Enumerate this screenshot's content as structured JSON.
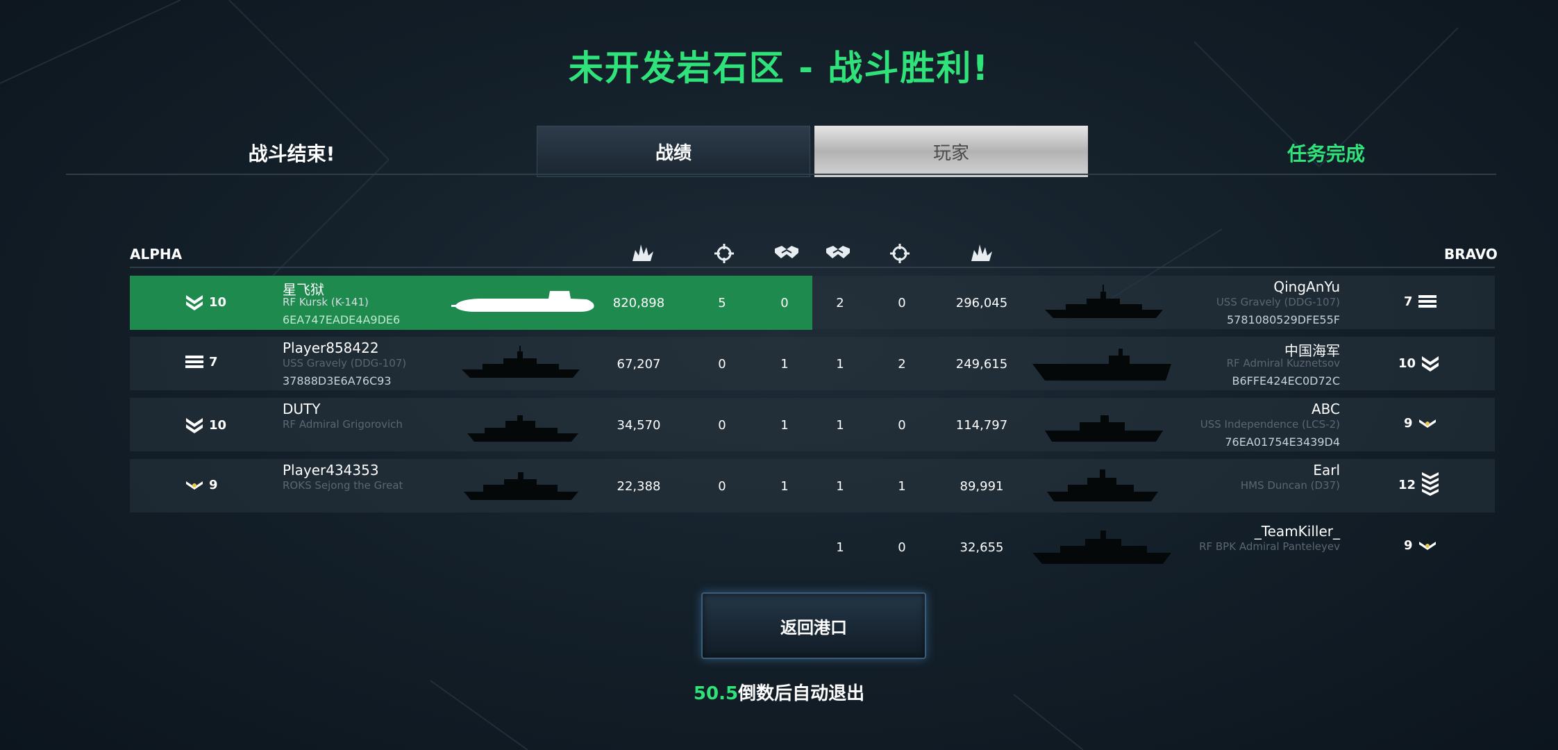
{
  "title": "未开发岩石区 - 战斗胜利!",
  "battle_over": "战斗结束!",
  "mission_complete": "任务完成",
  "tabs": {
    "stats": "战绩",
    "players": "玩家"
  },
  "teams": {
    "alpha": "ALPHA",
    "bravo": "BRAVO"
  },
  "columns": [
    "damage-icon",
    "target-icon",
    "handshake-icon"
  ],
  "alpha": [
    {
      "rank": "10",
      "rank_icon": "chevrons-icon",
      "name": "星飞狱",
      "ship": "RF Kursk (K-141)",
      "id": "6EA747EADE4A9DE6",
      "damage": "820,898",
      "kills": "5",
      "assists": "0"
    },
    {
      "rank": "7",
      "rank_icon": "bars-icon",
      "name": "Player858422",
      "ship": "USS Gravely (DDG-107)",
      "id": "37888D3E6A76C93",
      "damage": "67,207",
      "kills": "0",
      "assists": "1"
    },
    {
      "rank": "10",
      "rank_icon": "chevrons-icon",
      "name": "DUTY",
      "ship": "RF Admiral Grigorovich",
      "id": "",
      "damage": "34,570",
      "kills": "0",
      "assists": "1"
    },
    {
      "rank": "9",
      "rank_icon": "chevron-icon",
      "name": "Player434353",
      "ship": "ROKS Sejong the Great",
      "id": "",
      "damage": "22,388",
      "kills": "0",
      "assists": "1"
    }
  ],
  "bravo": [
    {
      "rank": "7",
      "rank_icon": "bars-icon",
      "name": "QingAnYu",
      "ship": "USS Gravely (DDG-107)",
      "id": "5781080529DFE55F",
      "damage": "296,045",
      "kills": "0",
      "assists": "2"
    },
    {
      "rank": "10",
      "rank_icon": "chevrons-icon",
      "name": "中国海军",
      "ship": "RF Admiral Kuznetsov",
      "id": "B6FFE424EC0D72C",
      "damage": "249,615",
      "kills": "2",
      "assists": "1"
    },
    {
      "rank": "9",
      "rank_icon": "chevron-icon",
      "name": "ABC",
      "ship": "USS Independence (LCS-2)",
      "id": "76EA01754E3439D4",
      "damage": "114,797",
      "kills": "0",
      "assists": "1"
    },
    {
      "rank": "12",
      "rank_icon": "stripes-icon",
      "name": "Earl",
      "ship": "HMS Duncan (D37)",
      "id": "",
      "damage": "89,991",
      "kills": "1",
      "assists": "1"
    },
    {
      "rank": "9",
      "rank_icon": "chevron-icon",
      "name": "_TeamKiller_",
      "ship": "RF BPK Admiral Panteleyev",
      "id": "",
      "damage": "32,655",
      "kills": "0",
      "assists": "1"
    }
  ],
  "return_button": "返回港口",
  "countdown": {
    "seconds": "50.5",
    "text": "倒数后自动退出"
  },
  "colors": {
    "accent": "#2fe37a",
    "highlight_row": "#1e8a4d"
  }
}
